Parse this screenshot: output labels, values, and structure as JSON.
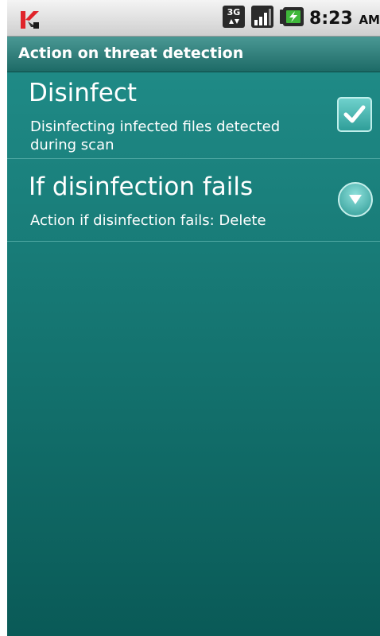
{
  "status_bar": {
    "time": "8:23",
    "ampm": "AM",
    "network_type": "3G",
    "icons": [
      "kaspersky-icon",
      "3g-data-icon",
      "signal-icon",
      "battery-charging-icon"
    ]
  },
  "header": {
    "title": "Action on threat detection"
  },
  "preferences": [
    {
      "title": "Disinfect",
      "summary": "Disinfecting infected files detected during scan",
      "control": "checkbox",
      "checked": true
    },
    {
      "title": "If disinfection fails",
      "summary": "Action if disinfection fails: Delete",
      "control": "dropdown-icon"
    }
  ],
  "colors": {
    "title_bar": "#2f807c",
    "content_bg": "#13716d",
    "checkbox": "#4fbab5",
    "text": "#ffffff"
  }
}
